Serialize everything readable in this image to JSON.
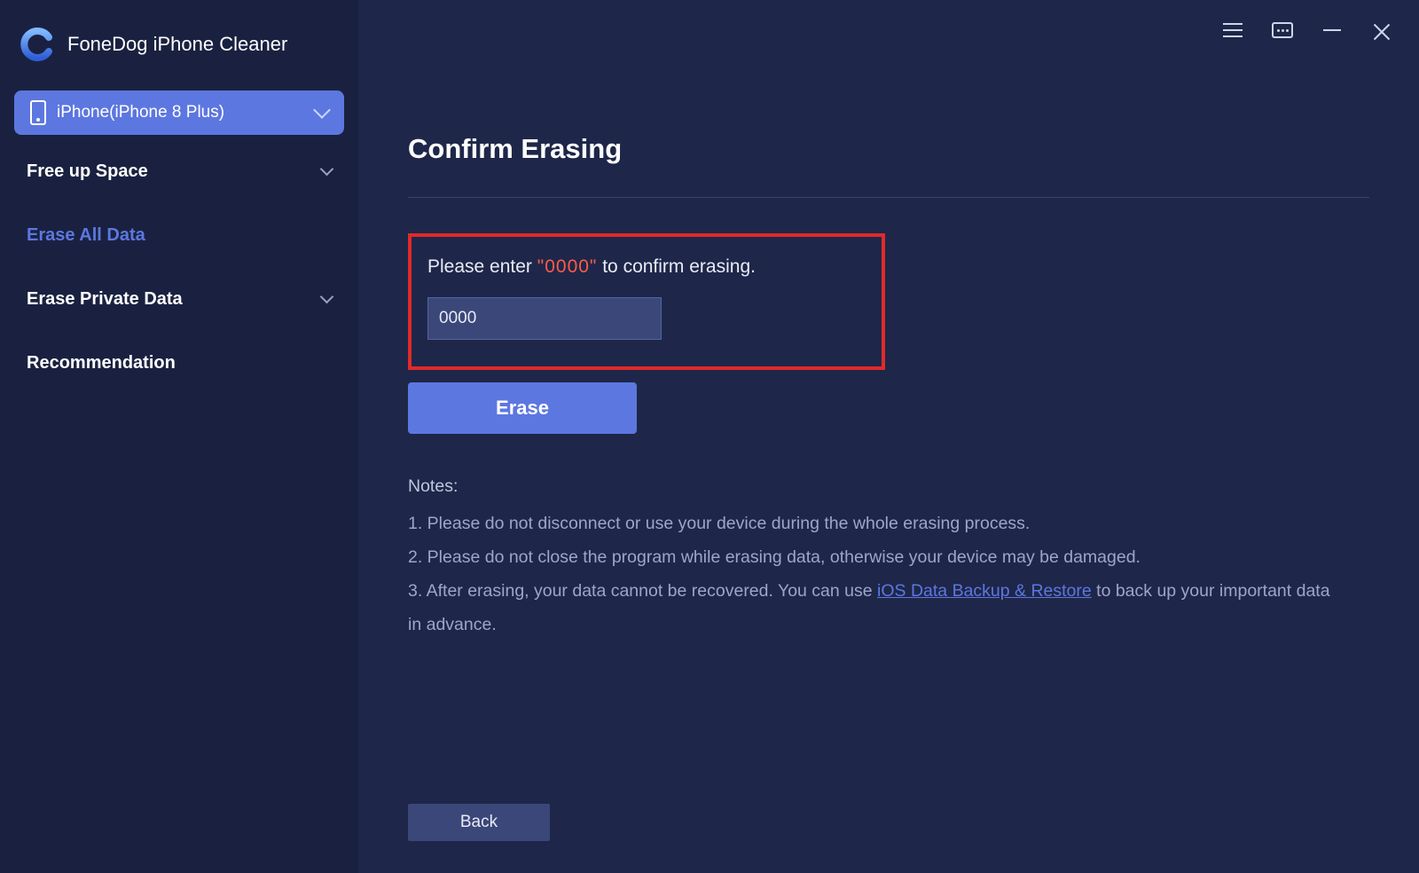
{
  "app": {
    "title": "FoneDog iPhone Cleaner"
  },
  "device": {
    "label": "iPhone(iPhone 8 Plus)"
  },
  "sidebar": {
    "items": [
      {
        "label": "Free up Space",
        "expandable": true,
        "active": false
      },
      {
        "label": "Erase All Data",
        "expandable": false,
        "active": true
      },
      {
        "label": "Erase Private Data",
        "expandable": true,
        "active": false
      },
      {
        "label": "Recommendation",
        "expandable": false,
        "active": false
      }
    ]
  },
  "main": {
    "title": "Confirm Erasing",
    "prompt_pre": "Please enter ",
    "prompt_code": "\"0000\"",
    "prompt_post": " to confirm erasing.",
    "input_value": "0000",
    "erase_label": "Erase",
    "back_label": "Back",
    "notes_heading": "Notes:",
    "note1": "1. Please do not disconnect or use your device during the whole erasing process.",
    "note2": "2. Please do not close the program while erasing data, otherwise your device may be damaged.",
    "note3_pre": "3. After erasing, your data cannot be recovered. You can use ",
    "note3_link": "iOS Data Backup & Restore",
    "note3_post": " to back up your important data in advance."
  }
}
